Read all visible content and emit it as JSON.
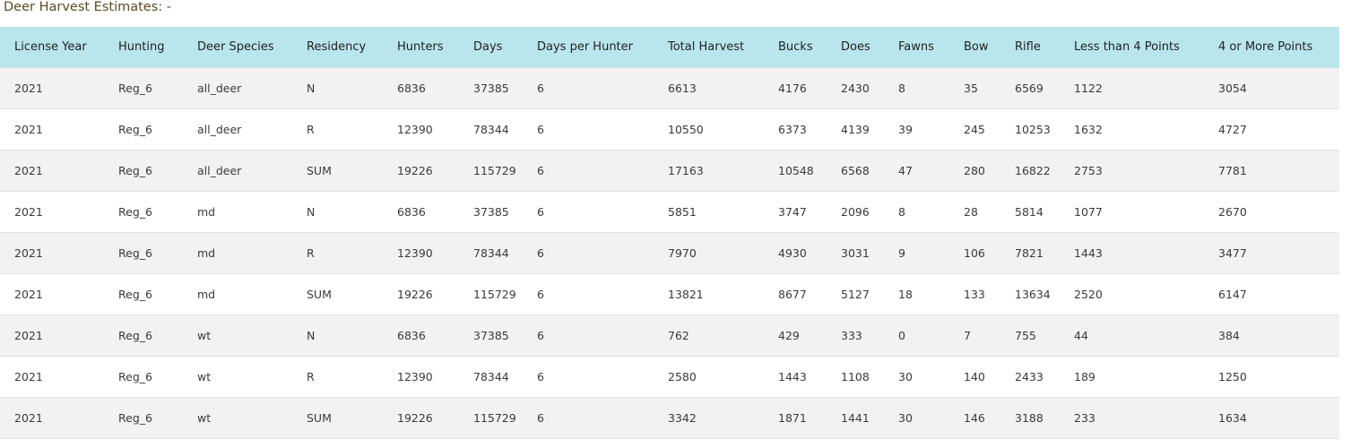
{
  "page": {
    "title": "Deer Harvest Estimates: -"
  },
  "colors": {
    "header_background": "#b9e6ec",
    "title_text": "#5b4a24",
    "odd_row": "#f2f2f2",
    "even_row": "#ffffff"
  },
  "table": {
    "columns": [
      "License Year",
      "Hunting",
      "Deer Species",
      "Residency",
      "Hunters",
      "Days",
      "Days per Hunter",
      "Total Harvest",
      "Bucks",
      "Does",
      "Fawns",
      "Bow",
      "Rifle",
      "Less than 4 Points",
      "4 or More Points"
    ],
    "rows": [
      [
        "2021",
        "Reg_6",
        "all_deer",
        "N",
        "6836",
        "37385",
        "6",
        "6613",
        "4176",
        "2430",
        "8",
        "35",
        "6569",
        "1122",
        "3054"
      ],
      [
        "2021",
        "Reg_6",
        "all_deer",
        "R",
        "12390",
        "78344",
        "6",
        "10550",
        "6373",
        "4139",
        "39",
        "245",
        "10253",
        "1632",
        "4727"
      ],
      [
        "2021",
        "Reg_6",
        "all_deer",
        "SUM",
        "19226",
        "115729",
        "6",
        "17163",
        "10548",
        "6568",
        "47",
        "280",
        "16822",
        "2753",
        "7781"
      ],
      [
        "2021",
        "Reg_6",
        "md",
        "N",
        "6836",
        "37385",
        "6",
        "5851",
        "3747",
        "2096",
        "8",
        "28",
        "5814",
        "1077",
        "2670"
      ],
      [
        "2021",
        "Reg_6",
        "md",
        "R",
        "12390",
        "78344",
        "6",
        "7970",
        "4930",
        "3031",
        "9",
        "106",
        "7821",
        "1443",
        "3477"
      ],
      [
        "2021",
        "Reg_6",
        "md",
        "SUM",
        "19226",
        "115729",
        "6",
        "13821",
        "8677",
        "5127",
        "18",
        "133",
        "13634",
        "2520",
        "6147"
      ],
      [
        "2021",
        "Reg_6",
        "wt",
        "N",
        "6836",
        "37385",
        "6",
        "762",
        "429",
        "333",
        "0",
        "7",
        "755",
        "44",
        "384"
      ],
      [
        "2021",
        "Reg_6",
        "wt",
        "R",
        "12390",
        "78344",
        "6",
        "2580",
        "1443",
        "1108",
        "30",
        "140",
        "2433",
        "189",
        "1250"
      ],
      [
        "2021",
        "Reg_6",
        "wt",
        "SUM",
        "19226",
        "115729",
        "6",
        "3342",
        "1871",
        "1441",
        "30",
        "146",
        "3188",
        "233",
        "1634"
      ]
    ]
  }
}
